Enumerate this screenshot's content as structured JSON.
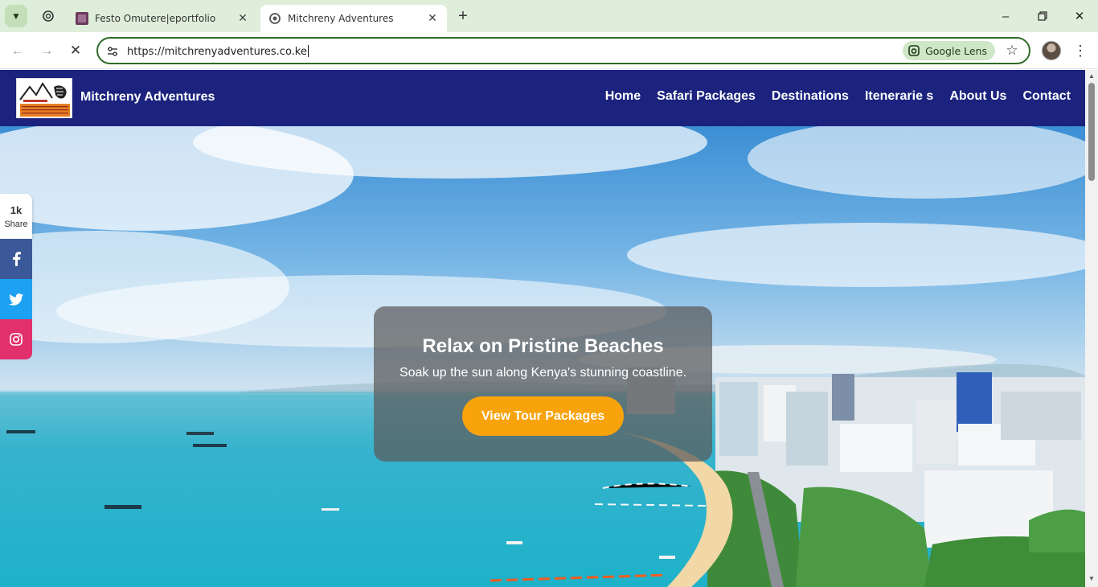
{
  "browser": {
    "tabs": [
      {
        "title": "Festo Omutere|eportfolio",
        "active": false
      },
      {
        "title": "Mitchreny Adventures",
        "active": true
      }
    ],
    "url": "https://mitchrenyadventures.co.ke",
    "lens_label": "Google Lens"
  },
  "site": {
    "brand": "Mitchreny Adventures",
    "nav": [
      "Home",
      "Safari Packages",
      "Destinations",
      "Itenerarie s",
      "About Us",
      "Contact"
    ],
    "hero": {
      "title": "Relax on Pristine Beaches",
      "subtitle": "Soak up the sun along Kenya's stunning coastline.",
      "cta": "View Tour Packages"
    },
    "share": {
      "count": "1k",
      "label": "Share"
    }
  },
  "colors": {
    "header_bg": "#1b237e",
    "cta": "#f9a30c",
    "facebook": "#3b5998",
    "twitter": "#1da1f2",
    "instagram": "#e1306c",
    "chrome_tabbar": "#dfeedb"
  }
}
